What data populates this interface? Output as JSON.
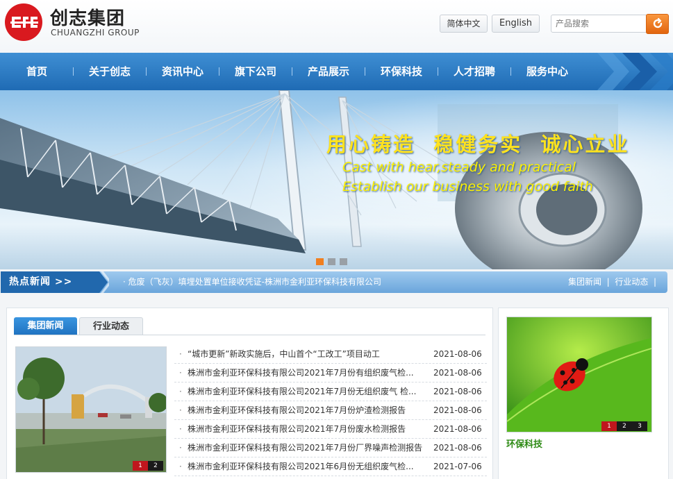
{
  "brand": {
    "name_cn": "创志集团",
    "name_en": "CHUANGZHI GROUP"
  },
  "header": {
    "lang_cn": "简体中文",
    "lang_en": "English",
    "search_placeholder": "产品搜索"
  },
  "nav": {
    "items": [
      "首页",
      "关于创志",
      "资讯中心",
      "旗下公司",
      "产品展示",
      "环保科技",
      "人才招聘",
      "服务中心"
    ]
  },
  "banner": {
    "slogan_cn": "用心铸造  稳健务实  诚心立业",
    "slogan_en_1": "Cast with hear,steady and practical",
    "slogan_en_2": "Establish our business with good faith",
    "dots": 3,
    "active_dot": 1
  },
  "hot_news": {
    "label": "热点新闻 >>",
    "headline": "· 危废（飞灰）填埋处置单位接收凭证-株洲市金利亚环保科技有限公司",
    "link_1": "集团新闻",
    "link_2": "行业动态"
  },
  "news_panel": {
    "tabs": [
      "集团新闻",
      "行业动态"
    ],
    "active_tab": 0,
    "photo_pager": [
      "1",
      "2"
    ],
    "items": [
      {
        "title": "“城市更新”新政实施后，中山首个“工改工”项目动工",
        "date": "2021-08-06"
      },
      {
        "title": "株洲市金利亚环保科技有限公司2021年7月份有组织废气检...",
        "date": "2021-08-06"
      },
      {
        "title": "株洲市金利亚环保科技有限公司2021年7月份无组织废气 检...",
        "date": "2021-08-06"
      },
      {
        "title": "株洲市金利亚环保科技有限公司2021年7月份炉渣检测报告",
        "date": "2021-08-06"
      },
      {
        "title": "株洲市金利亚环保科技有限公司2021年7月份废水检测报告",
        "date": "2021-08-06"
      },
      {
        "title": "株洲市金利亚环保科技有限公司2021年7月份厂界噪声检测报告",
        "date": "2021-08-06"
      },
      {
        "title": "株洲市金利亚环保科技有限公司2021年6月份无组织废气检...",
        "date": "2021-07-06"
      }
    ]
  },
  "side_panel": {
    "title": "环保科技",
    "pager": [
      "1",
      "2",
      "3"
    ]
  },
  "colors": {
    "nav_blue": "#2a7cc7",
    "accent_orange": "#f07f20",
    "brand_red": "#d9191f",
    "eco_green": "#2d8a14"
  }
}
